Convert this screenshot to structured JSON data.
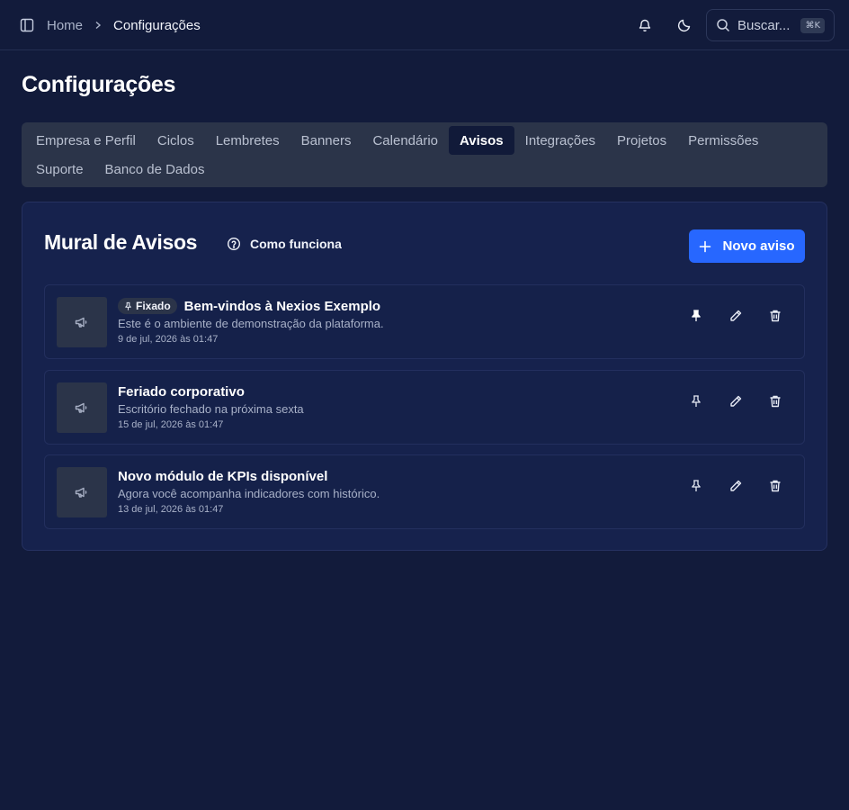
{
  "header": {
    "breadcrumb": {
      "home": "Home",
      "current": "Configurações"
    },
    "search": {
      "label": "Buscar...",
      "shortcut": "⌘K"
    },
    "icons": [
      "sidebar-toggle-icon",
      "bell-icon",
      "moon-icon",
      "search-icon"
    ]
  },
  "page": {
    "title": "Configurações"
  },
  "tabs": {
    "row1": [
      "Empresa e Perfil",
      "Ciclos",
      "Lembretes",
      "Banners",
      "Calendário",
      "Avisos",
      "Integrações",
      "Projetos",
      "Permissões"
    ],
    "row2": [
      "Suporte",
      "Banco de Dados"
    ],
    "active": "Avisos"
  },
  "card": {
    "title": "Mural de Avisos",
    "help_label": "Como funciona",
    "new_button": "Novo aviso"
  },
  "notices": [
    {
      "pinned": true,
      "pinned_label": "Fixado",
      "title": "Bem-vindos à Nexios Exemplo",
      "description": "Este é o ambiente de demonstração da plataforma.",
      "date": "9 de jul, 2026 às 01:47"
    },
    {
      "pinned": false,
      "title": "Feriado corporativo",
      "description": "Escritório fechado na próxima sexta",
      "date": "15 de jul, 2026 às 01:47"
    },
    {
      "pinned": false,
      "title": "Novo módulo de KPIs disponível",
      "description": "Agora você acompanha indicadores com histórico.",
      "date": "13 de jul, 2026 às 01:47"
    }
  ],
  "colors": {
    "background": "#121b3b",
    "card": "#16224d",
    "tabs_bg": "#2b3449",
    "primary": "#2767ff"
  }
}
